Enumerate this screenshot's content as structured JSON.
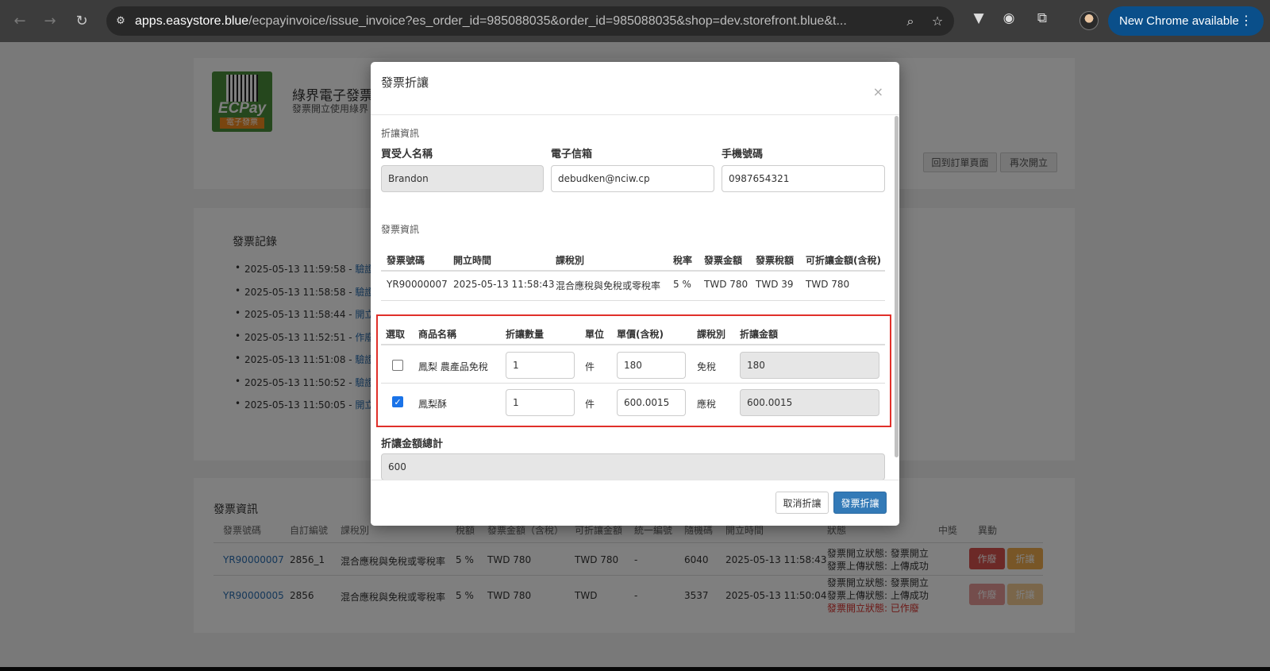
{
  "browser": {
    "url_host": "apps.easystore.blue",
    "url_path": "/ecpayinvoice/issue_invoice?es_order_id=985088035&order_id=985088035&shop=dev.storefront.blue&t...",
    "new_chrome_label": "New Chrome available"
  },
  "header": {
    "logo_brand": "ECPay",
    "logo_tag": "電子發票",
    "title": "綠界電子發票",
    "subtitle": "發票開立使用綠界",
    "back_button": "回到訂單頁面",
    "reissue_button": "再次開立"
  },
  "records": {
    "title": "發票記錄",
    "items": [
      {
        "time": "2025-05-13 11:59:58 - ",
        "link": "驗證"
      },
      {
        "time": "2025-05-13 11:58:58 - ",
        "link": "驗證"
      },
      {
        "time": "2025-05-13 11:58:44 - ",
        "link": "開立"
      },
      {
        "time": "2025-05-13 11:52:51 - ",
        "link": "作廢"
      },
      {
        "time": "2025-05-13 11:51:08 - ",
        "link": "驗證"
      },
      {
        "time": "2025-05-13 11:50:52 - ",
        "link": "驗證"
      },
      {
        "time": "2025-05-13 11:50:05 - ",
        "link": "開立"
      }
    ]
  },
  "invoice_list": {
    "title": "發票資訊",
    "headers": [
      "發票號碼",
      "自訂編號",
      "課稅別",
      "稅額",
      "發票金額（含稅）",
      "可折讓金額",
      "統一編號",
      "隨機碼",
      "開立時間",
      "狀態",
      "中獎",
      "異動"
    ],
    "rows": [
      {
        "no": "YR90000007",
        "custom": "2856_1",
        "tax_type": "混合應稅與免稅或零稅率",
        "rate": "5 %",
        "amount": "TWD 780",
        "allowance": "TWD 780",
        "tax_id": "-",
        "random": "6040",
        "time": "2025-05-13 11:58:43",
        "status1": "發票開立狀態: 發票開立",
        "status2": "發票上傳狀態: 上傳成功",
        "status3": "",
        "void": "作廢",
        "discount": "折讓"
      },
      {
        "no": "YR90000005",
        "custom": "2856",
        "tax_type": "混合應稅與免稅或零稅率",
        "rate": "5 %",
        "amount": "TWD 780",
        "allowance": "TWD",
        "tax_id": "-",
        "random": "3537",
        "time": "2025-05-13 11:50:04",
        "status1": "發票開立狀態: 發票開立",
        "status2": "發票上傳狀態: 上傳成功",
        "status3": "發票開立狀態: 已作廢",
        "void": "作廢",
        "discount": "折讓"
      }
    ]
  },
  "modal": {
    "title": "發票折讓",
    "close": "×",
    "allowance_section": "折讓資訊",
    "buyer_label": "買受人名稱",
    "buyer_value": "Brandon",
    "email_label": "電子信箱",
    "email_value": "debudken@nciw.cp",
    "phone_label": "手機號碼",
    "phone_value": "0987654321",
    "invoice_section": "發票資訊",
    "invoice_headers": [
      "發票號碼",
      "開立時間",
      "課稅別",
      "稅率",
      "發票金額",
      "發票稅額",
      "可折讓金額(含稅)"
    ],
    "invoice_row": [
      "YR90000007",
      "2025-05-13 11:58:43",
      "混合應稅與免稅或零稅率",
      "5 %",
      "TWD 780",
      "TWD 39",
      "TWD 780"
    ],
    "item_headers": [
      "選取",
      "商品名稱",
      "折讓數量",
      "單位",
      "單價(含稅)",
      "課稅別",
      "折讓金額"
    ],
    "items": [
      {
        "checked": false,
        "name": "鳳梨 農產品免稅",
        "qty": "1",
        "unit": "件",
        "price": "180",
        "tax": "免稅",
        "amount": "180"
      },
      {
        "checked": true,
        "name": "鳳梨酥",
        "qty": "1",
        "unit": "件",
        "price": "600.0015",
        "tax": "應稅",
        "amount": "600.0015"
      }
    ],
    "total_label": "折讓金額總計",
    "total_value": "600",
    "cancel_button": "取消折讓",
    "submit_button": "發票折讓"
  }
}
